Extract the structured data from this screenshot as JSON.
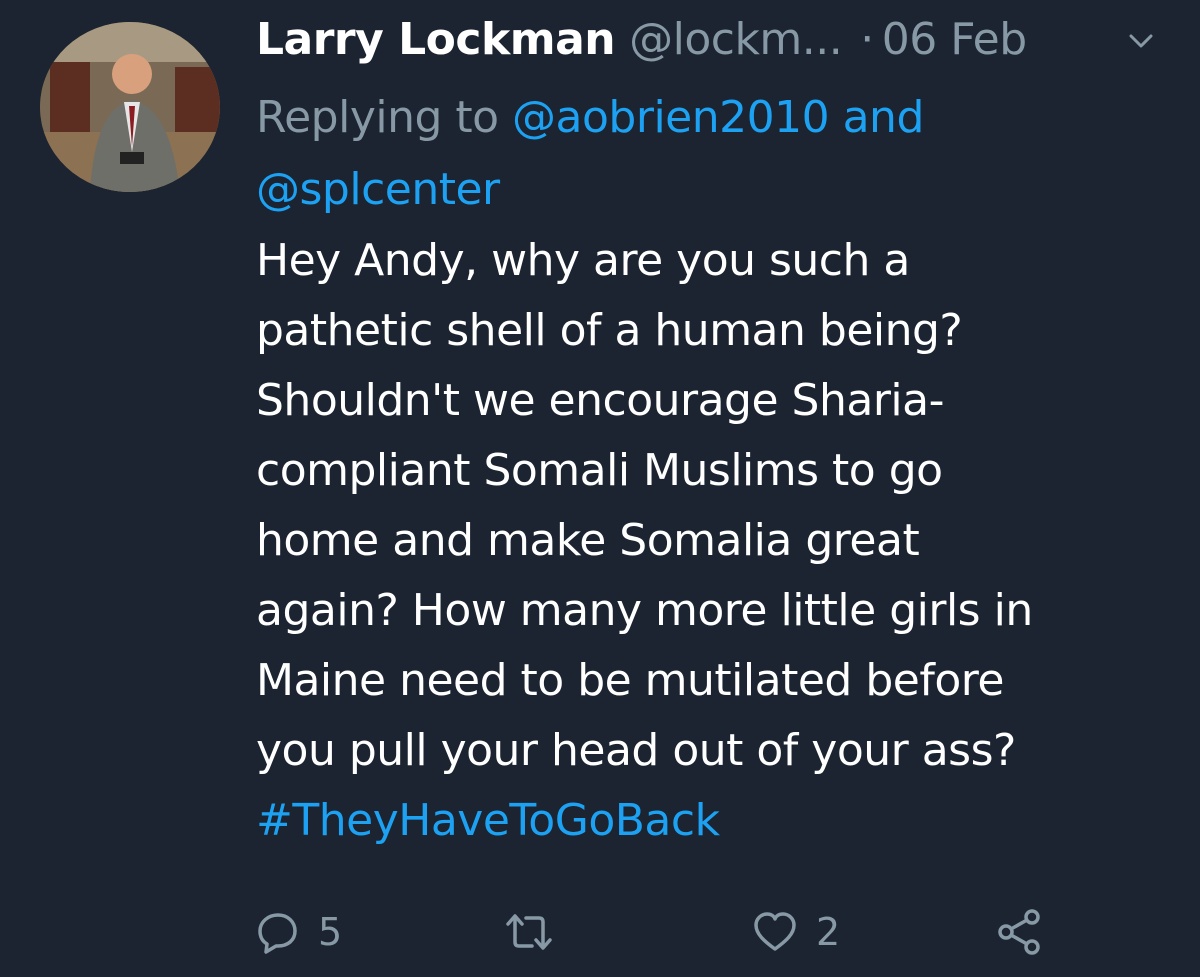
{
  "tweet": {
    "author_name": "Larry Lockman",
    "author_handle": "@lockm...",
    "separator": "·",
    "date": "06 Feb",
    "reply_prefix": "Replying to ",
    "reply_mention_1": "@aobrien2010",
    "reply_and": " and",
    "reply_mention_2": "@splcenter",
    "body_lines": [
      "Hey Andy, why are you such a",
      "pathetic shell of a human being?",
      "Shouldn't we encourage Sharia-",
      "compliant Somali Muslims to go",
      "home and make Somalia great",
      "again? How many more little girls in",
      "Maine need to be mutilated before",
      "you pull your head out of your ass?"
    ],
    "hashtag": "#TheyHaveToGoBack"
  },
  "actions": {
    "reply_icon": "reply-icon",
    "reply_count": "5",
    "retweet_icon": "retweet-icon",
    "like_icon": "heart-icon",
    "like_count": "2",
    "share_icon": "share-icon"
  },
  "colors": {
    "background": "#1b2430",
    "text": "#ffffff",
    "muted": "#8899a6",
    "link": "#1da1f2"
  }
}
